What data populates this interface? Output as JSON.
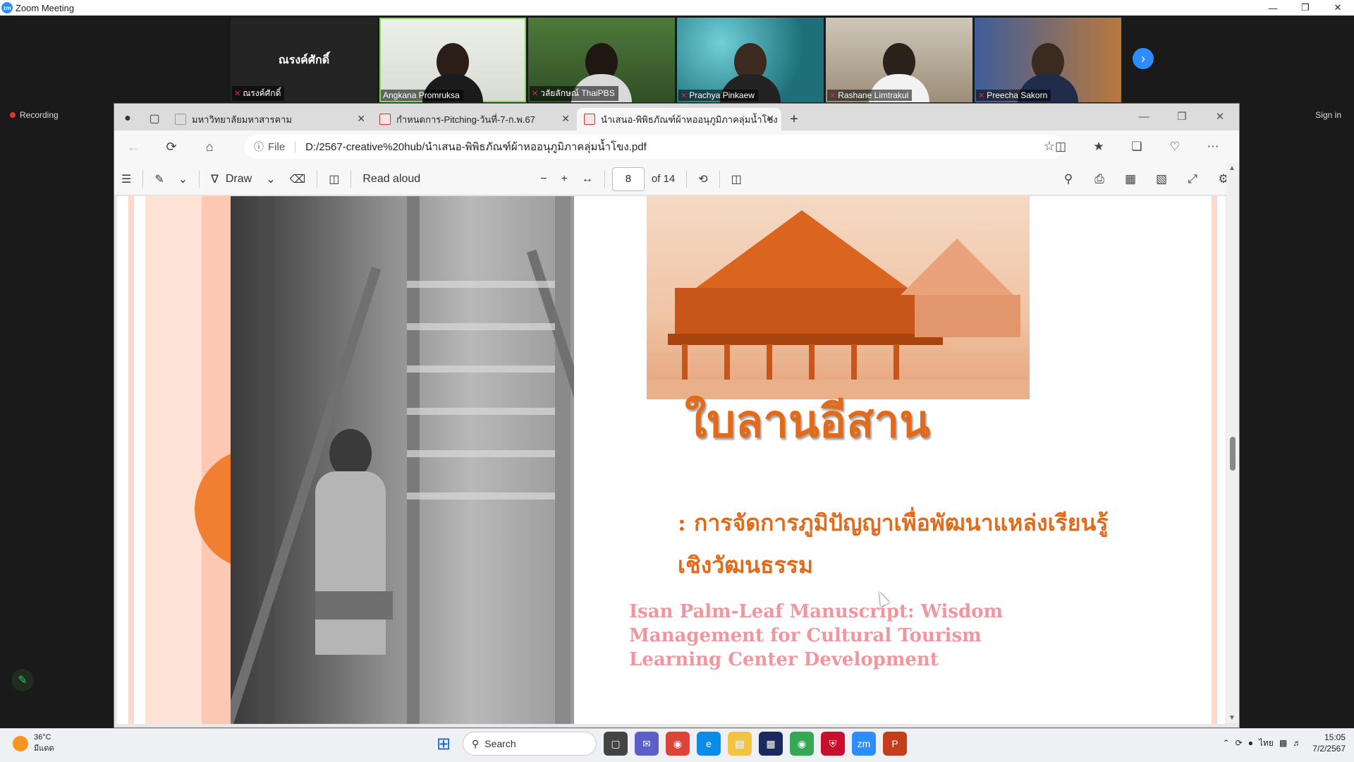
{
  "zoom": {
    "window_title": "Zoom Meeting",
    "recording_label": "Recording",
    "sign_in_label": "Sign in",
    "participants": [
      {
        "name": "ณรงค์ศักดิ์",
        "center_name": "ณรงค์ศักดิ์",
        "muted": true
      },
      {
        "name": "Angkana Promruksa",
        "muted": false
      },
      {
        "name": "วลัยลักษณ์ ThaiPBS",
        "muted": true
      },
      {
        "name": "Prachya Pinkaew",
        "muted": true
      },
      {
        "name": "Rashane Limtrakul",
        "muted": true
      },
      {
        "name": "Preecha Sakorn",
        "muted": true
      }
    ]
  },
  "browser": {
    "tabs": [
      {
        "label": "มหาวิทยาลัยมหาสารคาม",
        "icon": "page-icon",
        "active": false
      },
      {
        "label": "กำหนดการ-Pitching-วันที่-7-ก.พ.67",
        "icon": "pdf-icon",
        "active": false
      },
      {
        "label": "นำเสนอ-พิพิธภัณฑ์ผ้าหออนุภูมิภาคลุ่มน้ำโขง",
        "icon": "pdf-icon",
        "active": true
      }
    ],
    "address": {
      "scheme_label": "File",
      "url": "D:/2567-creative%20hub/นำเสนอ-พิพิธภัณฑ์ผ้าหออนุภูมิภาคลุ่มน้ำโขง.pdf"
    },
    "pdf_toolbar": {
      "draw_label": "Draw",
      "read_aloud_label": "Read aloud",
      "page_current": "8",
      "page_total_label": "of 14"
    }
  },
  "slide": {
    "thai_title": "ใบลานอีสาน",
    "thai_subtitle_line1": ": การจัดการภูมิปัญญาเพื่อพัฒนาแหล่งเรียนรู้",
    "thai_subtitle_line2": "เชิงวัฒนธรรม",
    "english_title_line1": "Isan Palm-Leaf Manuscript: Wisdom",
    "english_title_line2": "Management for Cultural Tourism",
    "english_title_line3": "Learning Center Development"
  },
  "taskbar": {
    "weather_temp": "36°C",
    "weather_desc": "มีแดด",
    "search_label": "Search",
    "language": "ไทย",
    "time": "15:05",
    "date": "7/2/2567"
  }
}
